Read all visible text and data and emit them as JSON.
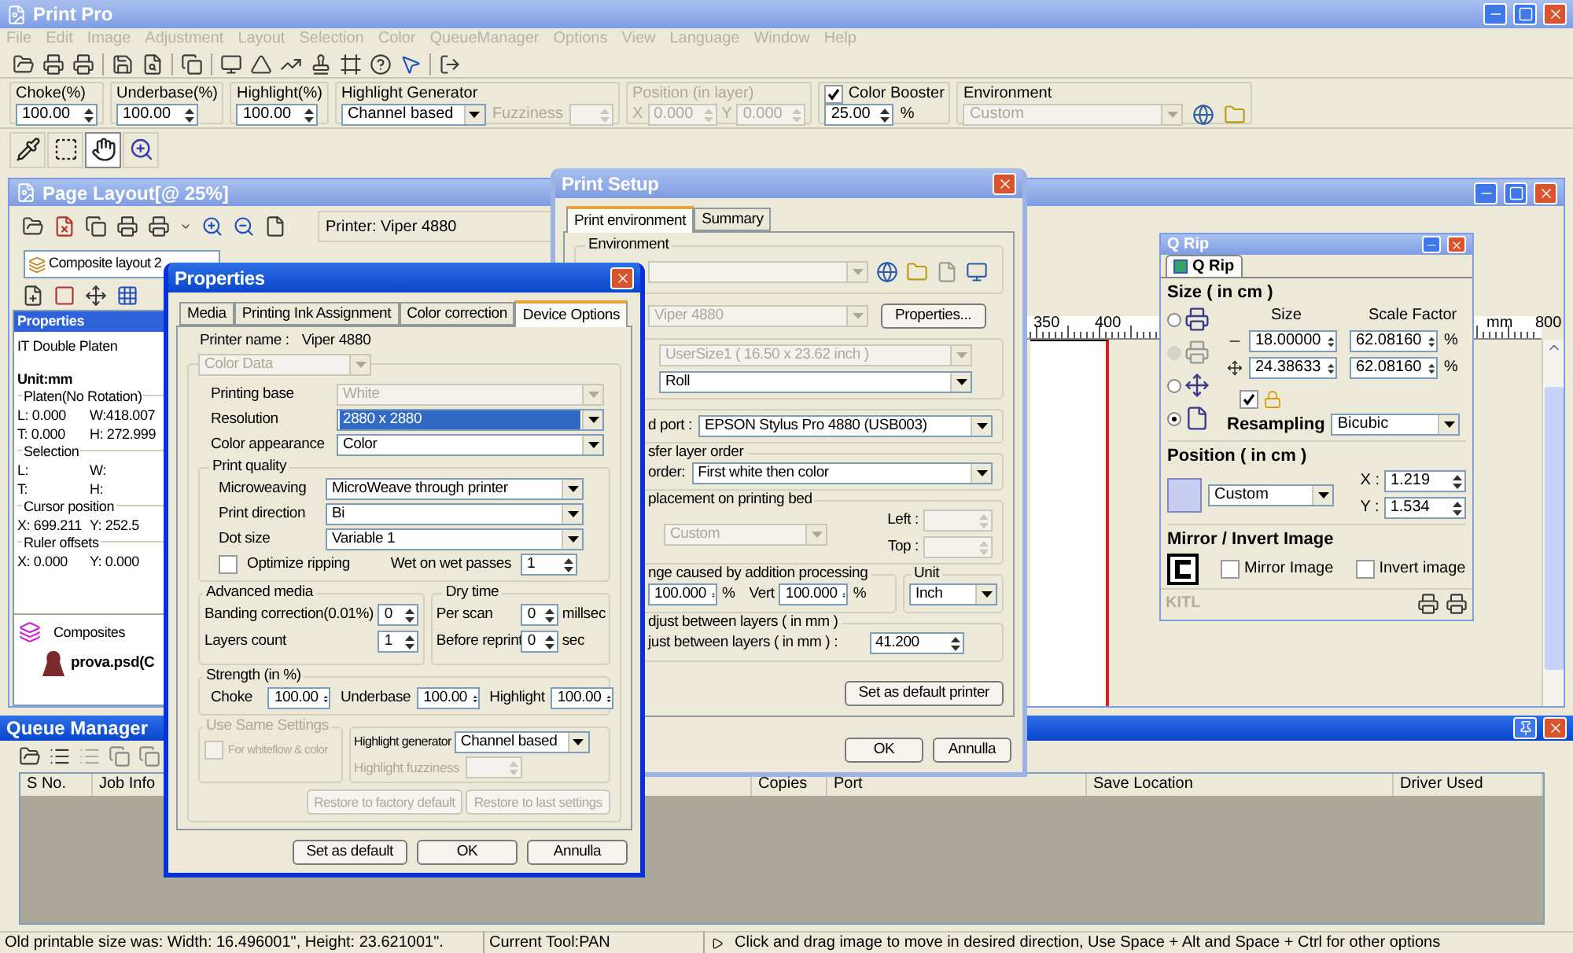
{
  "window": {
    "title": "Print Pro"
  },
  "menu": [
    {
      "label": "File",
      "disabled": true
    },
    {
      "label": "Edit",
      "disabled": true
    },
    {
      "label": "Image",
      "disabled": true
    },
    {
      "label": "Adjustment",
      "disabled": true
    },
    {
      "label": "Layout",
      "disabled": true
    },
    {
      "label": "Selection",
      "disabled": true
    },
    {
      "label": "Color",
      "disabled": true
    },
    {
      "label": "QueueManager",
      "disabled": true
    },
    {
      "label": "Options",
      "disabled": true
    },
    {
      "label": "View",
      "disabled": true
    },
    {
      "label": "Language",
      "disabled": true
    },
    {
      "label": "Window",
      "disabled": true
    },
    {
      "label": "Help",
      "disabled": true
    }
  ],
  "options_bar": {
    "spins": [
      {
        "label": "Choke(%)",
        "value": "100.00"
      },
      {
        "label": "Underbase(%)",
        "value": "100.00"
      },
      {
        "label": "Highlight(%)",
        "value": "100.00"
      }
    ],
    "highlight_generator": {
      "label": "Highlight Generator",
      "value": "Channel based",
      "fuzziness_label": "Fuzziness",
      "fuzziness_disabled": true
    },
    "position": {
      "label": "Position (in layer)",
      "disabled": true,
      "fields": [
        {
          "label": "X",
          "value": "0.000"
        },
        {
          "label": "Y",
          "value": "0.000"
        }
      ]
    },
    "color_booster": {
      "label": "Color Booster",
      "checked": true,
      "value": "25.00",
      "unit": "%"
    },
    "environment": {
      "label": "Environment",
      "value": "Custom",
      "disabled": true
    }
  },
  "tools": [
    {
      "kind": "eyedropper",
      "selected": false
    },
    {
      "kind": "marquee",
      "selected": false
    },
    {
      "kind": "hand",
      "selected": true
    },
    {
      "kind": "zoom",
      "selected": false
    }
  ],
  "page_layout": {
    "title": "Page Layout[@ 25%]",
    "printer": "Printer:  Viper 4880",
    "composite": "Composite layout 2",
    "properties": {
      "title": "Properties",
      "platen_type": "IT Double Platen",
      "unit": "Unit:mm",
      "groups": [
        {
          "title": "Platen(No Rotation)",
          "rows": [
            [
              "L: 0.000",
              "W:418.007"
            ],
            [
              "T: 0.000",
              "H: 272.999"
            ]
          ]
        },
        {
          "title": "Selection",
          "rows": [
            [
              "L:",
              "W:"
            ],
            [
              "T:",
              "H:"
            ]
          ]
        },
        {
          "title": "Cursor position",
          "rows": [
            [
              "X: 699.211",
              "Y: 252.5"
            ]
          ]
        },
        {
          "title": "Ruler offsets",
          "rows": [
            [
              "X: 0.000",
              "Y: 0.000"
            ]
          ]
        }
      ]
    },
    "composites": {
      "title": "Composites",
      "items": [
        {
          "label": "prova.psd(C"
        }
      ]
    },
    "ruler": {
      "labels": [
        "350",
        "400",
        "mm",
        "800"
      ]
    }
  },
  "properties_dialog": {
    "title": "Properties",
    "tabs": [
      {
        "label": "Media",
        "selected": false
      },
      {
        "label": "Printing Ink Assignment",
        "selected": false
      },
      {
        "label": "Color correction",
        "selected": false
      },
      {
        "label": "Device Options",
        "selected": true
      }
    ],
    "printer_name_label": "Printer name :",
    "printer_name": "Viper 4880",
    "color_data": {
      "value": "Color Data",
      "disabled": true
    },
    "fields": [
      {
        "label": "Printing base",
        "value": "White",
        "disabled": true,
        "highlighted": false
      },
      {
        "label": "Resolution",
        "value": "2880 x 2880",
        "disabled": false,
        "highlighted": true
      },
      {
        "label": "Color appearance",
        "value": "Color",
        "disabled": false,
        "highlighted": false
      }
    ],
    "print_quality": {
      "title": "Print quality",
      "fields": [
        {
          "label": "Microweaving",
          "value": "MicroWeave through printer"
        },
        {
          "label": "Print direction",
          "value": "Bi"
        },
        {
          "label": "Dot size",
          "value": "Variable 1"
        }
      ],
      "optimize": {
        "label": "Optimize ripping",
        "checked": false
      },
      "wet_label": "Wet on wet passes",
      "wet_value": "1"
    },
    "advanced_media": {
      "title": "Advanced media",
      "rows": [
        {
          "label": "Banding correction(0.01%)",
          "value": "0"
        },
        {
          "label": "Layers count",
          "value": "1"
        }
      ]
    },
    "dry_time": {
      "title": "Dry time",
      "rows": [
        {
          "label": "Per scan",
          "value": "0",
          "unit": "millsec"
        },
        {
          "label": "Before reprint",
          "value": "0",
          "unit": "sec"
        }
      ]
    },
    "strength": {
      "title": "Strength (in %)",
      "items": [
        {
          "label": "Choke",
          "value": "100.00"
        },
        {
          "label": "Underbase",
          "value": "100.00"
        },
        {
          "label": "Highlight",
          "value": "100.00"
        }
      ]
    },
    "same_settings": {
      "title": "Use Same Settings",
      "label": "For whiteflow & color",
      "checked": false,
      "disabled": true
    },
    "highlight_generator": {
      "label": "Highlight generator",
      "value": "Channel based",
      "fuzziness": "Highlight fuzziness",
      "fuzziness_disabled": true
    },
    "restore_buttons": [
      {
        "label": "Restore to factory default",
        "disabled": true
      },
      {
        "label": "Restore to last settings",
        "disabled": true
      }
    ],
    "buttons": [
      "Set as default",
      "OK",
      "Annulla"
    ]
  },
  "print_setup": {
    "title": "Print Setup",
    "tabs": [
      {
        "label": "Print environment",
        "selected": true
      },
      {
        "label": "Summary",
        "selected": false
      }
    ],
    "environment": {
      "title": "Environment",
      "disabled": true
    },
    "printer": {
      "value": "Viper 4880",
      "disabled": true,
      "button": "Properties..."
    },
    "media": [
      {
        "value": "UserSize1 ( 16.50 x 23.62 inch )",
        "disabled": true
      },
      {
        "value": "Roll",
        "disabled": false
      }
    ],
    "port": {
      "label": "d port :",
      "value": "EPSON Stylus Pro 4880 (USB003)"
    },
    "layer_order": {
      "title": "sfer layer order",
      "label": "order:",
      "value": "First white then color"
    },
    "placement": {
      "title": "placement on printing bed",
      "value": "Custom",
      "disabled": true,
      "fields": [
        {
          "label": "Left :"
        },
        {
          "label": "Top :"
        }
      ]
    },
    "size_change": {
      "title": "nge caused by addition processing",
      "fields": [
        {
          "value": "100.000",
          "unit": "%"
        },
        {
          "label": "Vert",
          "value": "100.000",
          "unit": "%"
        }
      ]
    },
    "unit": {
      "title": "Unit",
      "value": "Inch"
    },
    "adjust": {
      "title": "djust between layers ( in mm )",
      "label": "just between layers ( in mm ) :",
      "value": "41.200"
    },
    "default_button": "Set as default printer",
    "buttons": [
      "OK",
      "Annulla"
    ]
  },
  "q_rip": {
    "title": "Q Rip",
    "tab": "Q Rip",
    "size": {
      "title": "Size ( in cm )",
      "modes": [
        {
          "selected": false,
          "disabled": false
        },
        {
          "selected": false,
          "disabled": true
        },
        {
          "selected": false,
          "disabled": false
        },
        {
          "selected": true,
          "disabled": false
        }
      ],
      "size_header": "Size",
      "scale_header": "Scale Factor",
      "rows": [
        {
          "size": "18.00000",
          "scale": "62.08160",
          "unit": "%"
        },
        {
          "size": "24.38633",
          "scale": "62.08160",
          "unit": "%"
        }
      ],
      "lock_checked": true,
      "resampling_label": "Resampling",
      "resampling": "Bicubic"
    },
    "position": {
      "title": "Position ( in cm )",
      "value": "Custom",
      "fields": [
        {
          "label": "X :",
          "value": "1.219"
        },
        {
          "label": "Y :",
          "value": "1.534"
        }
      ]
    },
    "mirror": {
      "title": "Mirror / Invert Image",
      "options": [
        {
          "label": "Mirror Image",
          "checked": false
        },
        {
          "label": "Invert image",
          "checked": false
        }
      ]
    },
    "footer": "KITL"
  },
  "queue_manager": {
    "title": "Queue Manager",
    "columns": [
      "S No.",
      "Job Info",
      "Copies",
      "Port",
      "Save Location",
      "Driver Used"
    ]
  },
  "status_bar": {
    "size": "Old printable size was: Width: 16.496001\", Height: 23.621001\".",
    "tool": "Current Tool:PAN",
    "hint": "Click and drag image to move in desired direction, Use Space + Alt and Space + Ctrl for other options"
  }
}
